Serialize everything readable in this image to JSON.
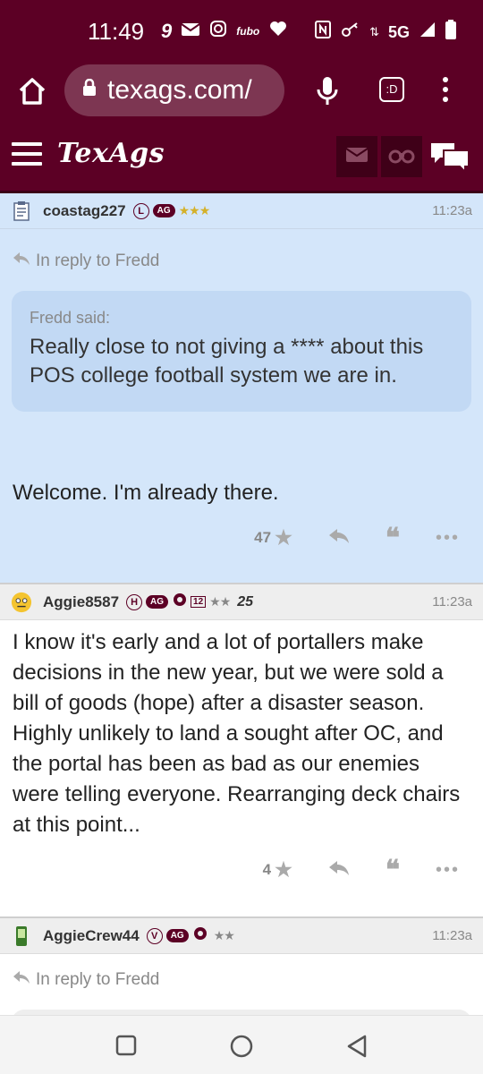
{
  "status_bar": {
    "time": "11:49",
    "network": "5G",
    "left_icons": [
      "nine-app-icon",
      "gmail-icon",
      "instagram-icon",
      "fubo-icon",
      "iheart-icon"
    ],
    "right_icons": [
      "nfc-icon",
      "key-icon",
      "network-arrows-icon",
      "signal-icon",
      "battery-icon"
    ],
    "fubo_label": "fubo"
  },
  "browser": {
    "url": "texags.com/",
    "tab_badge": ":D"
  },
  "site": {
    "brand": "TexAgs"
  },
  "posts": [
    {
      "username": "coastag227",
      "badges": [
        "L",
        "AG"
      ],
      "stars": "★★★",
      "timestamp": "11:23a",
      "reply_to": "In reply to Fredd",
      "quote_author": "Fredd said:",
      "quote_text": "Really close to not giving a **** about this POS college football system we are in.",
      "body": "Welcome. I'm already there.",
      "likes": "47"
    },
    {
      "username": "Aggie8587",
      "badges": [
        "H",
        "AG",
        "12"
      ],
      "stars": "★★",
      "extra_badge": "25",
      "timestamp": "11:23a",
      "body": "I know it's early and a lot of portallers make decisions in the new year, but we were sold a bill of goods (hope) after a disaster season. Highly unlikely to land a sought after OC, and the portal has been as bad as our enemies were telling everyone. Rearranging deck chairs at this point...",
      "likes": "4"
    },
    {
      "username": "AggieCrew44",
      "badges": [
        "V",
        "AG"
      ],
      "stars": "★★",
      "timestamp": "11:23a",
      "reply_to": "In reply to Fredd"
    }
  ],
  "colors": {
    "maroon": "#5c0025",
    "highlight_post": "#d4e6fa",
    "quote_bg": "#c2d9f4"
  }
}
